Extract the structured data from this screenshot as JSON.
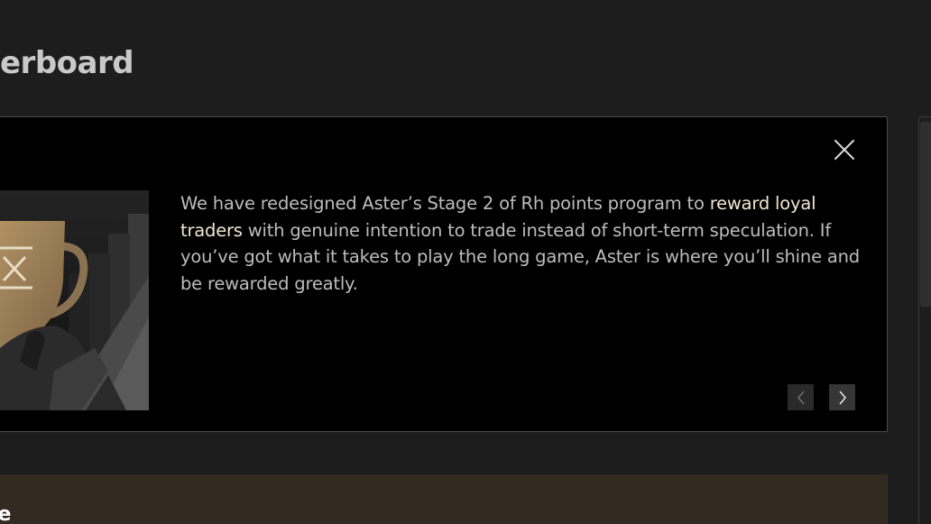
{
  "page": {
    "title": "erboard"
  },
  "modal": {
    "message_part1": "We have redesigned Aster’s Stage 2 of Rh points program to ",
    "message_highlight": "reward loyal traders",
    "message_part2": " with genuine intention to trade instead of short-term speculation. If you’ve got what it takes to play the long game, Aster is where you’ll shine and be rewarded greatly.",
    "close_icon": "close-icon",
    "prev_icon": "chevron-left-icon",
    "next_icon": "chevron-right-icon",
    "highlight_color": "#f2e6d2",
    "accent_color": "#a68a5c"
  },
  "bottom_card": {
    "text": "le"
  }
}
